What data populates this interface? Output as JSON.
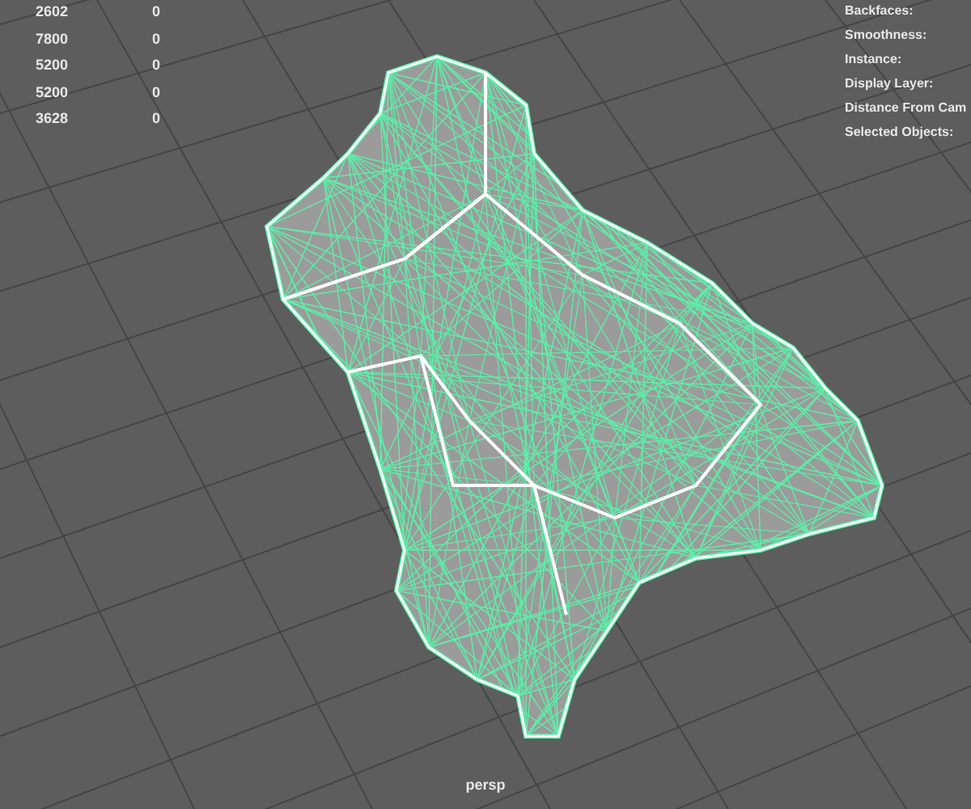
{
  "hud_left": {
    "rows": [
      {
        "value": "2602",
        "count": "0"
      },
      {
        "value": "7800",
        "count": "0"
      },
      {
        "value": "5200",
        "count": "0"
      },
      {
        "value": "5200",
        "count": "0"
      },
      {
        "value": "3628",
        "count": "0"
      }
    ]
  },
  "hud_right": {
    "labels": [
      "Backfaces:",
      "Smoothness:",
      "Instance:",
      "Display Layer:",
      "Distance From Cam",
      "Selected Objects:"
    ]
  },
  "camera_label": "persp"
}
